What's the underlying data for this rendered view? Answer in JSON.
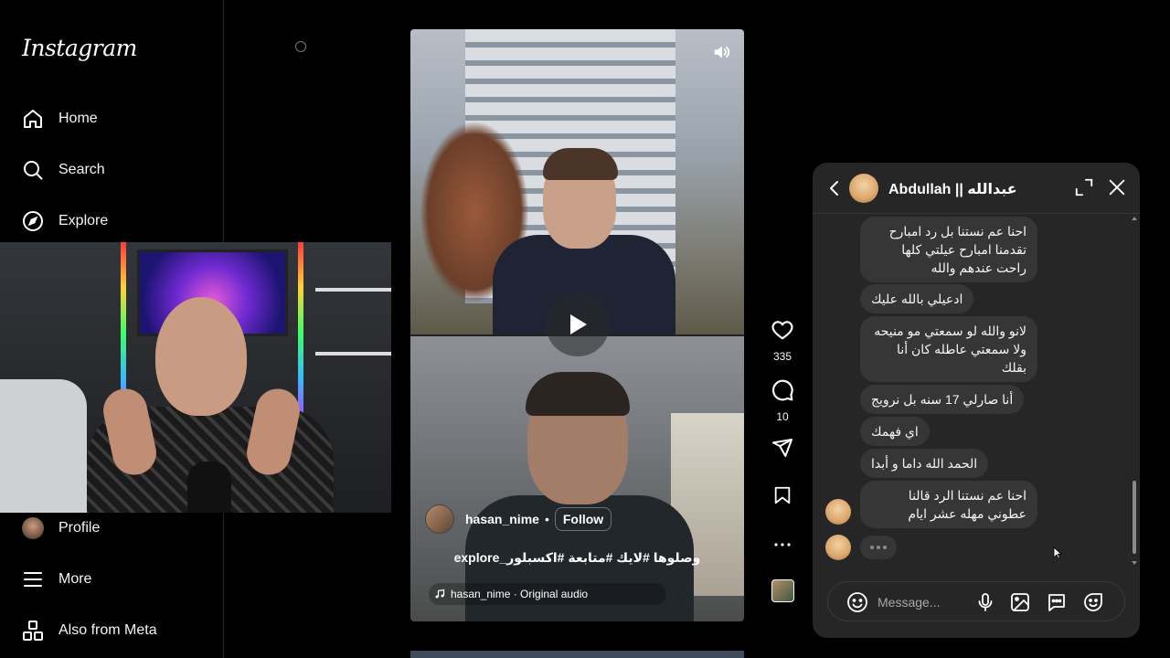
{
  "sidebar": {
    "logo": "Instagram",
    "items": [
      {
        "label": "Home",
        "icon": "home-icon"
      },
      {
        "label": "Search",
        "icon": "search-icon"
      },
      {
        "label": "Explore",
        "icon": "compass-icon"
      },
      {
        "label": "Profile",
        "icon": "avatar"
      },
      {
        "label": "More",
        "icon": "menu-icon"
      },
      {
        "label": "Also from Meta",
        "icon": "meta-grid-icon"
      }
    ]
  },
  "reel": {
    "username": "hasan_nime",
    "separator": "•",
    "follow_label": "Follow",
    "caption": "وصلوها #لايك #متابعة #اكسبلور_explore",
    "audio": "hasan_nime · Original audio"
  },
  "actions": {
    "likes": "335",
    "comments": "10"
  },
  "chat": {
    "title": "Abdullah || عبدالله",
    "messages": [
      {
        "text": "احنا عم نستنا بل رد امبارح تقدمنا امبارح عيلتي كلها راحت عندهم والله"
      },
      {
        "text": "ادعيلي بالله عليك"
      },
      {
        "text": "لانو والله لو سمعتي مو منيحه ولا سمعتي عاطله كان أنا بقلك"
      },
      {
        "text": "أنا صارلي 17 سنه بل نرويج"
      },
      {
        "text": "اي فهمك"
      },
      {
        "text": "الحمد الله داما و أبدا"
      },
      {
        "text": "احنا عم نستنا الرد قالنا عطوني مهله عشر ايام"
      }
    ],
    "placeholder": "Message..."
  }
}
